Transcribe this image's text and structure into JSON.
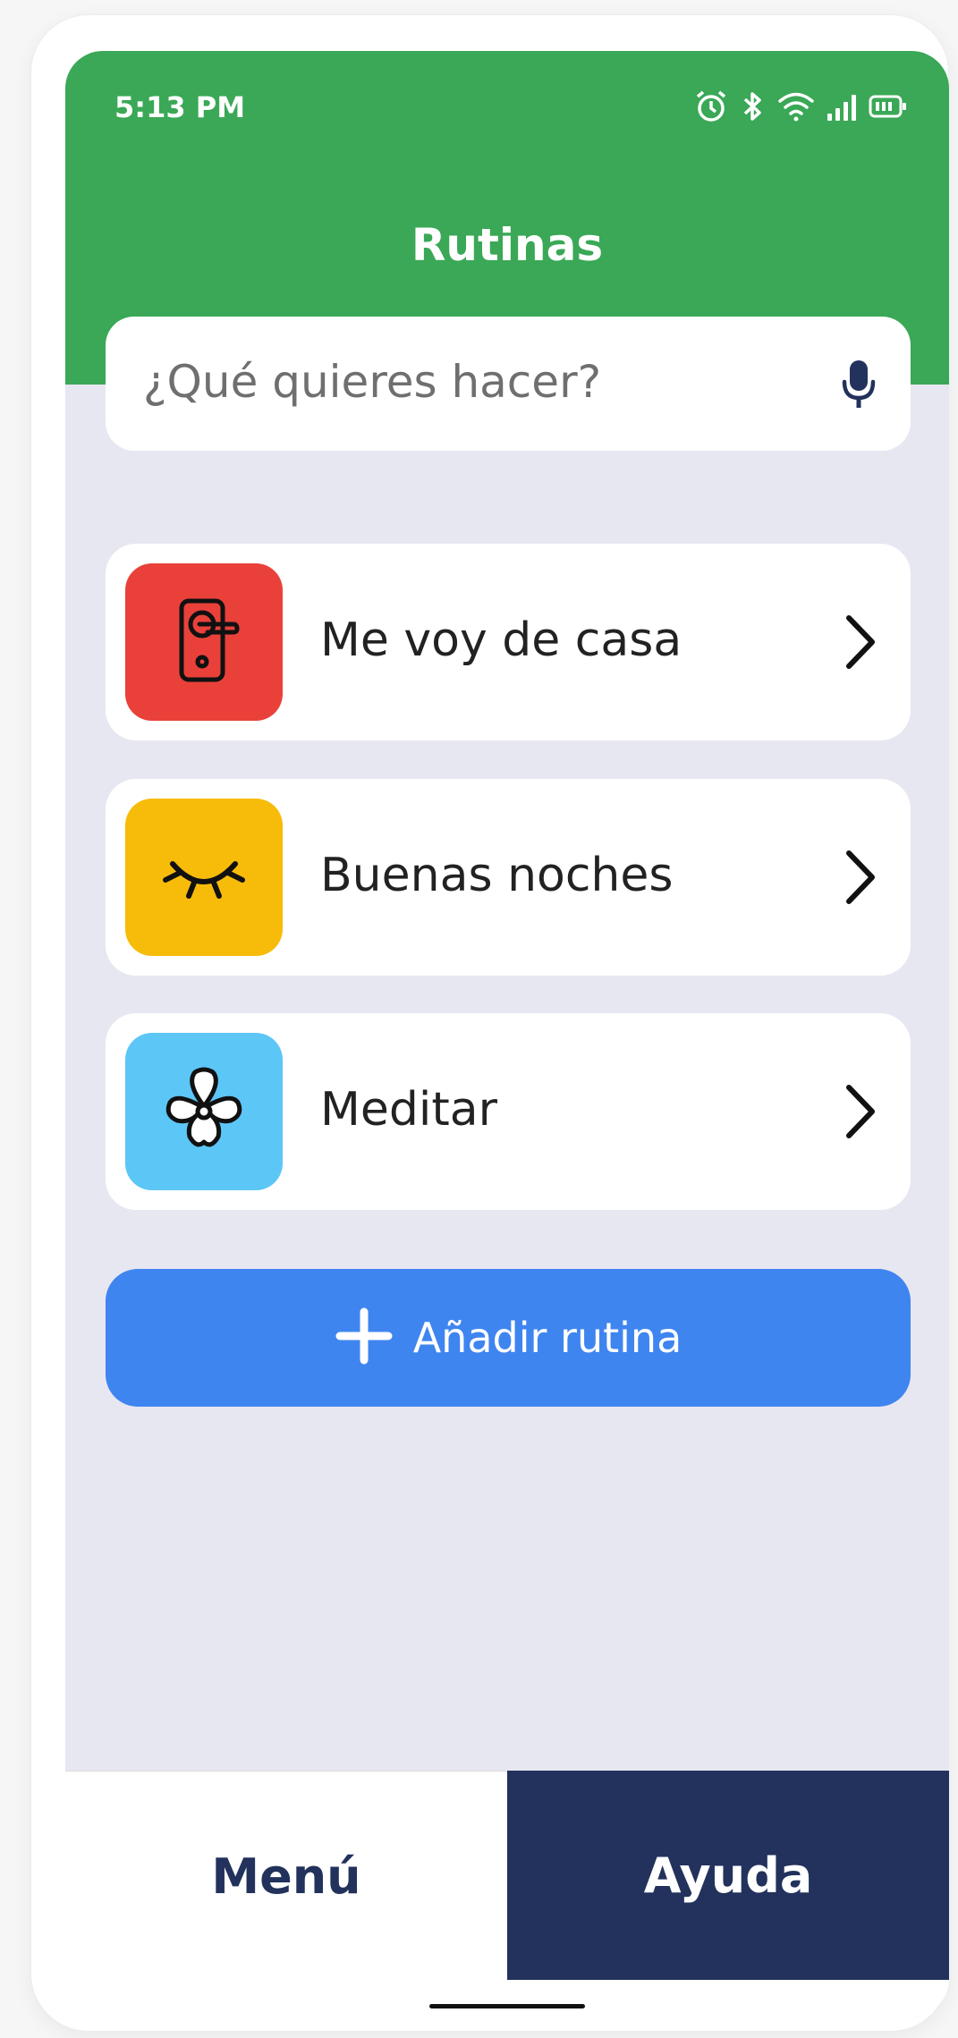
{
  "status_bar": {
    "time": "5:13 PM",
    "icons": [
      "alarm-icon",
      "bluetooth-icon",
      "wifi-icon",
      "signal-icon",
      "battery-icon"
    ]
  },
  "header": {
    "title": "Rutinas",
    "color": "#3aa856"
  },
  "search": {
    "placeholder": "¿Qué quieres hacer?",
    "icon": "microphone-icon"
  },
  "routines": [
    {
      "label": "Me voy de casa",
      "icon": "door-lock-icon",
      "color": "#e9413a"
    },
    {
      "label": "Buenas noches",
      "icon": "closed-eye-icon",
      "color": "#f7bc0a"
    },
    {
      "label": "Meditar",
      "icon": "flower-icon",
      "color": "#5cc6f7"
    }
  ],
  "add_button": {
    "label": "Añadir rutina",
    "icon": "plus-icon",
    "color": "#3f85f0"
  },
  "bottom_nav": {
    "menu_label": "Menú",
    "help_label": "Ayuda",
    "help_color": "#22325c"
  }
}
